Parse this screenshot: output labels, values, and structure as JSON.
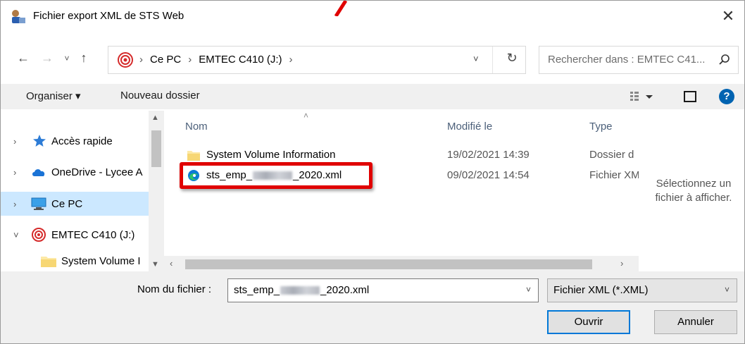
{
  "window": {
    "title": "Fichier export XML de STS Web",
    "close_glyph": "✕"
  },
  "nav": {
    "back_glyph": "←",
    "forward_glyph": "→",
    "recent_glyph": "˅",
    "up_glyph": "↑",
    "breadcrumbs": [
      "Ce PC",
      "EMTEC C410 (J:)"
    ],
    "sep_glyph": "›",
    "dropdown_glyph": "˅",
    "refresh_glyph": "↻",
    "search_placeholder": "Rechercher dans : EMTEC C41..."
  },
  "toolbar": {
    "organise_label": "Organiser ▾",
    "new_folder_label": "Nouveau dossier",
    "help_glyph": "?"
  },
  "sidebar": {
    "items": [
      {
        "label": "Accès rapide",
        "chevron": "›",
        "icon": "star-icon",
        "selected": false
      },
      {
        "label": "OneDrive - Lycee A",
        "chevron": "›",
        "icon": "cloud-icon",
        "selected": false
      },
      {
        "label": "Ce PC",
        "chevron": "›",
        "icon": "computer-icon",
        "selected": true
      },
      {
        "label": "EMTEC C410 (J:)",
        "chevron": "˅",
        "icon": "usb-drive-icon",
        "selected": false
      },
      {
        "label": "System Volume I",
        "chevron": "",
        "icon": "folder-icon",
        "selected": false
      }
    ]
  },
  "files": {
    "columns": {
      "name": "Nom",
      "modified": "Modifié le",
      "type": "Type"
    },
    "sort_glyph": "˄",
    "rows": [
      {
        "name": "System Volume Information",
        "modified": "19/02/2021 14:39",
        "type": "Dossier d",
        "icon": "folder-icon"
      },
      {
        "name_prefix": "sts_emp_",
        "name_suffix": "_2020.xml",
        "modified": "09/02/2021 14:54",
        "type": "Fichier XM",
        "icon": "edge-icon"
      }
    ]
  },
  "preview": {
    "line1": "Sélectionnez un",
    "line2": "fichier à afficher."
  },
  "footer": {
    "filename_label": "Nom du fichier :",
    "filename_prefix": "sts_emp_",
    "filename_suffix": "_2020.xml",
    "filetype_value": "Fichier XML (*.XML)",
    "open_label": "Ouvrir",
    "cancel_label": "Annuler"
  },
  "colors": {
    "highlight": "#e00000",
    "selection": "#cce8ff",
    "accent": "#0078d7"
  }
}
